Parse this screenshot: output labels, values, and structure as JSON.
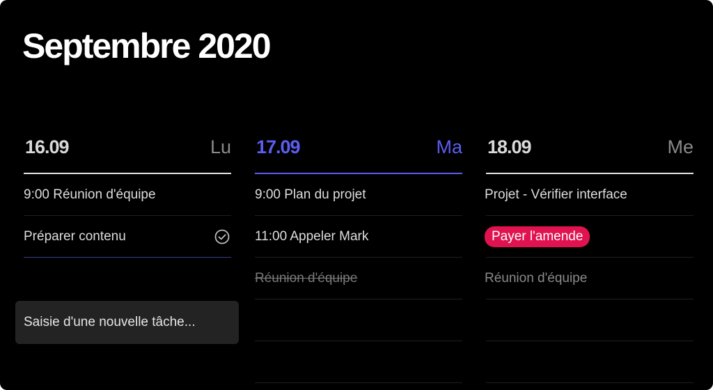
{
  "header": {
    "title": "Septembre 2020"
  },
  "columns": [
    {
      "date": "16.09",
      "day": "Lu",
      "tasks": [
        {
          "text": "9:00 Réunion d'équipe"
        },
        {
          "text": "Préparer contenu"
        }
      ]
    },
    {
      "date": "17.09",
      "day": "Ma",
      "tasks": [
        {
          "text": "9:00 Plan du projet"
        },
        {
          "text": "11:00 Appeler Mark"
        },
        {
          "text": "Réunion d'équipe"
        }
      ]
    },
    {
      "date": "18.09",
      "day": "Me",
      "tasks": [
        {
          "text": "Projet - Vérifier interface"
        },
        {
          "text": "Payer l'amende"
        },
        {
          "text": "Réunion d'équipe"
        }
      ]
    }
  ],
  "new_task_input": {
    "placeholder": "Saisie d'une nouvelle tâche..."
  },
  "colors": {
    "accent": "#5b5ef0",
    "badge": "#e0124f",
    "background": "#000000"
  },
  "icons": {
    "complete": "check-circle-icon"
  }
}
